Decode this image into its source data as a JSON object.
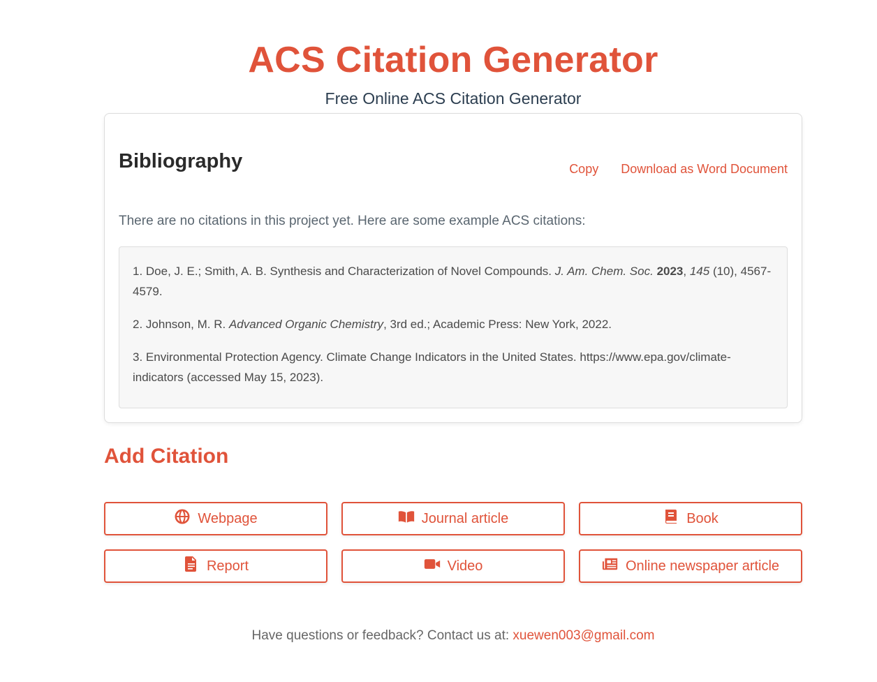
{
  "header": {
    "title": "ACS Citation Generator",
    "subtitle": "Free Online ACS Citation Generator"
  },
  "bibliography": {
    "heading": "Bibliography",
    "copy_label": "Copy",
    "download_label": "Download as Word Document",
    "empty_message": "There are no citations in this project yet. Here are some example ACS citations:",
    "examples": [
      {
        "n": "1. ",
        "authors": "Doe, J. E.; Smith, A. B. Synthesis and Characterization of Novel Compounds. ",
        "journal": "J. Am. Chem. Soc.",
        "year": "2023",
        "volume": "145",
        "rest": " (10), 4567-4579."
      },
      {
        "n": "2. ",
        "authors": "Johnson, M. R. ",
        "title": "Advanced Organic Chemistry",
        "rest": ", 3rd ed.; Academic Press: New York, 2022."
      },
      {
        "n": "3. ",
        "text": "Environmental Protection Agency. Climate Change Indicators in the United States. https://www.epa.gov/climate-indicators (accessed May 15, 2023)."
      }
    ]
  },
  "add_citation": {
    "heading": "Add Citation",
    "buttons": [
      {
        "label": "Webpage",
        "icon": "globe-icon"
      },
      {
        "label": "Journal article",
        "icon": "open-book-icon"
      },
      {
        "label": "Book",
        "icon": "book-icon"
      },
      {
        "label": "Report",
        "icon": "file-icon"
      },
      {
        "label": "Video",
        "icon": "video-camera-icon"
      },
      {
        "label": "Online newspaper article",
        "icon": "newspaper-icon"
      }
    ]
  },
  "footer": {
    "text": "Have questions or feedback? Contact us at: ",
    "email": "xuewen003@gmail.com"
  },
  "colors": {
    "accent": "#e0533a",
    "subtitle": "#2c3e50"
  }
}
